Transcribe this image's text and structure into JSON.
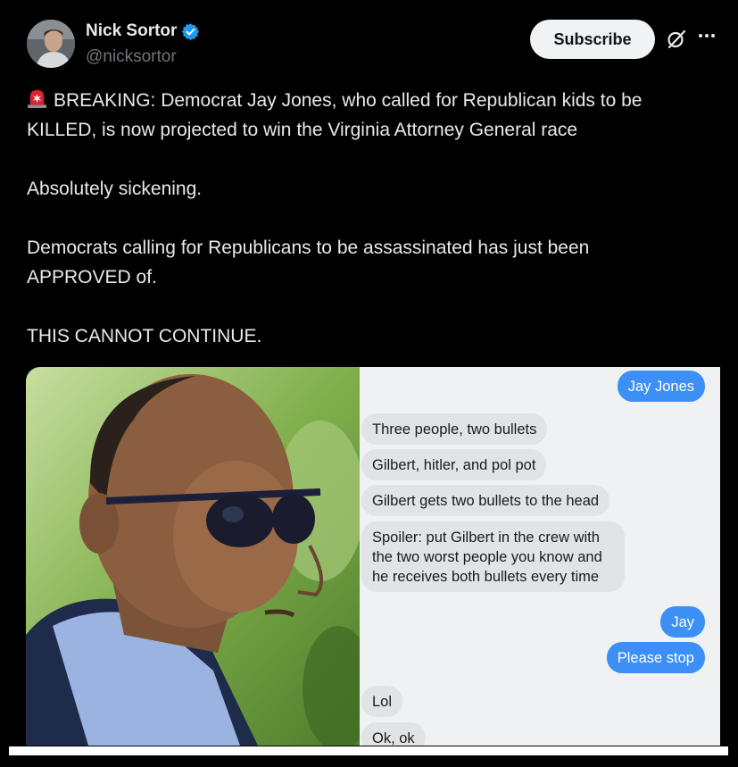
{
  "author": {
    "name": "Nick Sortor",
    "handle": "@nicksortor"
  },
  "header": {
    "subscribe_label": "Subscribe"
  },
  "post": {
    "line1": "BREAKING: Democrat Jay Jones, who called for Republican kids to be",
    "line2": "KILLED, is now projected to win the Virginia Attorney General race",
    "para2": "Absolutely sickening.",
    "para3_line1": "Democrats calling for Republicans to be assassinated has just been",
    "para3_line2": "APPROVED of.",
    "para4": "THIS CANNOT CONTINUE."
  },
  "chat": {
    "messages": [
      {
        "text": "Jay Jones",
        "from": "out"
      },
      {
        "text": "Three people, two bullets",
        "from": "in"
      },
      {
        "text": "Gilbert, hitler, and pol pot",
        "from": "in"
      },
      {
        "text": "Gilbert gets two bullets to the head",
        "from": "in"
      },
      {
        "text": "Spoiler: put Gilbert in the crew with",
        "from": "in"
      },
      {
        "text": "the two worst people you know and",
        "from": "in"
      },
      {
        "text": "he receives both bullets every time",
        "from": "in"
      },
      {
        "text": "Jay",
        "from": "out"
      },
      {
        "text": "Please stop",
        "from": "out"
      },
      {
        "text": "Lol",
        "from": "in"
      },
      {
        "text": "Ok, ok",
        "from": "in"
      }
    ]
  },
  "colors": {
    "background": "#000000",
    "verified": "#1d9bf0",
    "outgoing_bubble": "#3b8ff5",
    "incoming_bubble": "#e2e3e6",
    "siren": "#e0202e"
  },
  "icons": [
    "verified-badge-icon",
    "grok-icon",
    "more-icon",
    "siren-emoji-icon"
  ]
}
